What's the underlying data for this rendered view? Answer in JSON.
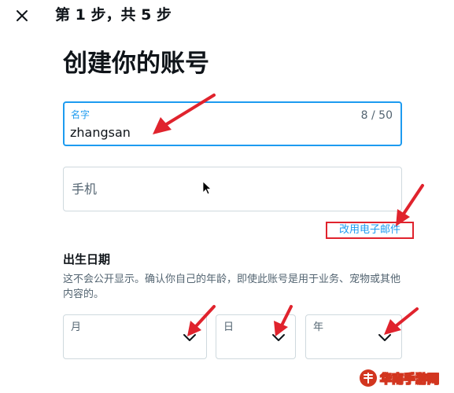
{
  "header": {
    "step_text": "第 1 步，共 5 步",
    "close_icon": "close-icon"
  },
  "page": {
    "title": "创建你的账号"
  },
  "name_field": {
    "label": "名字",
    "counter": "8 / 50",
    "value": "zhangsan"
  },
  "phone_field": {
    "placeholder": "手机"
  },
  "email_link": {
    "label": "改用电子邮件"
  },
  "dob": {
    "title": "出生日期",
    "description": "这不会公开显示。确认你自己的年龄，即使此账号是用于业务、宠物或其他内容的。",
    "month_label": "月",
    "day_label": "日",
    "year_label": "年"
  },
  "watermark": {
    "text": "华南手游网"
  },
  "colors": {
    "accent": "#1d9bf0",
    "annotation_red": "#e0232d",
    "border": "#cfd9de",
    "muted_text": "#536471"
  }
}
